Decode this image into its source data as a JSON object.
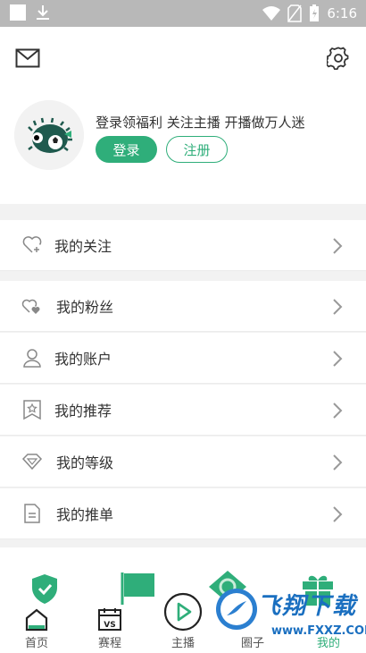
{
  "status_bar": {
    "time": "6:16"
  },
  "header": {
    "icons": [
      "mail-icon",
      "settings-icon"
    ]
  },
  "profile": {
    "slogan": "登录领福利 关注主播 开播做万人迷",
    "login_label": "登录",
    "register_label": "注册"
  },
  "menu": {
    "items": [
      {
        "label": "我的关注",
        "icon": "heart-plus-icon"
      },
      {
        "label": "我的粉丝",
        "icon": "hearts-icon"
      },
      {
        "label": "我的账户",
        "icon": "user-icon"
      },
      {
        "label": "我的推荐",
        "icon": "bookmark-star-icon"
      },
      {
        "label": "我的等级",
        "icon": "diamond-icon"
      },
      {
        "label": "我的推单",
        "icon": "document-icon"
      }
    ]
  },
  "tabbar": {
    "tabs": [
      {
        "label": "首页",
        "icon": "home-icon"
      },
      {
        "label": "赛程",
        "icon": "calendar-vs-icon"
      },
      {
        "label": "主播",
        "icon": "play-circle-icon"
      },
      {
        "label": "圈子",
        "icon": "circle-icon"
      },
      {
        "label": "我的",
        "icon": "profile-icon"
      }
    ]
  },
  "watermark": {
    "text": "飞翔下载",
    "url": "www.FXXZ.COM"
  },
  "colors": {
    "accent": "#2fae7a",
    "background": "#f2f2f2",
    "status_bar": "#b8b8b8"
  }
}
